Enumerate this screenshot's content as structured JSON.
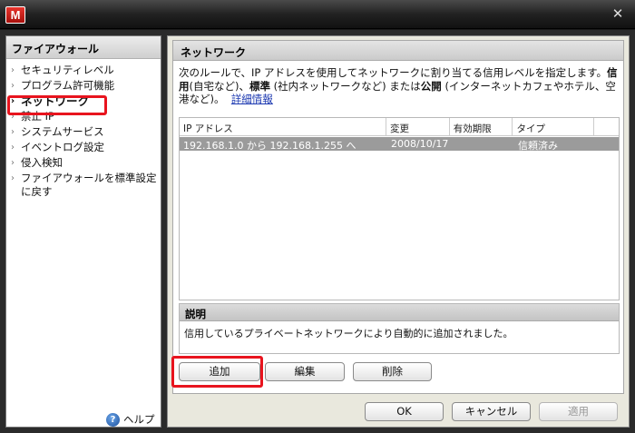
{
  "window": {
    "logo_letter": "M",
    "close_glyph": "✕"
  },
  "sidebar": {
    "title": "ファイアウォール",
    "items": [
      {
        "label": "セキュリティレベル",
        "active": false
      },
      {
        "label": "プログラム許可機能",
        "active": false
      },
      {
        "label": "ネットワーク",
        "active": true
      },
      {
        "label": "禁止 IP",
        "active": false
      },
      {
        "label": "システムサービス",
        "active": false
      },
      {
        "label": "イベントログ設定",
        "active": false
      },
      {
        "label": "侵入検知",
        "active": false
      },
      {
        "label": "ファイアウォールを標準設定に戻す",
        "active": false
      }
    ],
    "help_label": "ヘルプ",
    "help_icon": "?"
  },
  "main": {
    "title": "ネットワーク",
    "description": {
      "part1": "次のルールで、IP アドレスを使用してネットワークに割り当てる信用レベルを指定します。",
      "trusted": "信用",
      "part2": "(自宅など)、",
      "standard": "標準",
      "part3": "(社内ネットワークなど) または",
      "public": "公開",
      "part4": "(インターネットカフェやホテル、空港など)。",
      "link": "詳細情報"
    },
    "table": {
      "columns": [
        "IP アドレス",
        "変更",
        "有効期限",
        "タイプ",
        ""
      ],
      "rows": [
        {
          "ip": "192.168.1.0 から 192.168.1.255 へ",
          "changed": "2008/10/17",
          "expires": "",
          "type": "信頼済み"
        }
      ]
    },
    "explanation": {
      "title": "説明",
      "text": "信用しているプライベートネットワークにより自動的に追加されました。"
    },
    "buttons": {
      "add": "追加",
      "edit": "編集",
      "delete": "削除"
    }
  },
  "footer": {
    "ok": "OK",
    "cancel": "キャンセル",
    "apply": "適用"
  },
  "colors": {
    "highlight_box": "#e8141e",
    "selected_row": "#9b9b9b",
    "link": "#1a37b0"
  }
}
